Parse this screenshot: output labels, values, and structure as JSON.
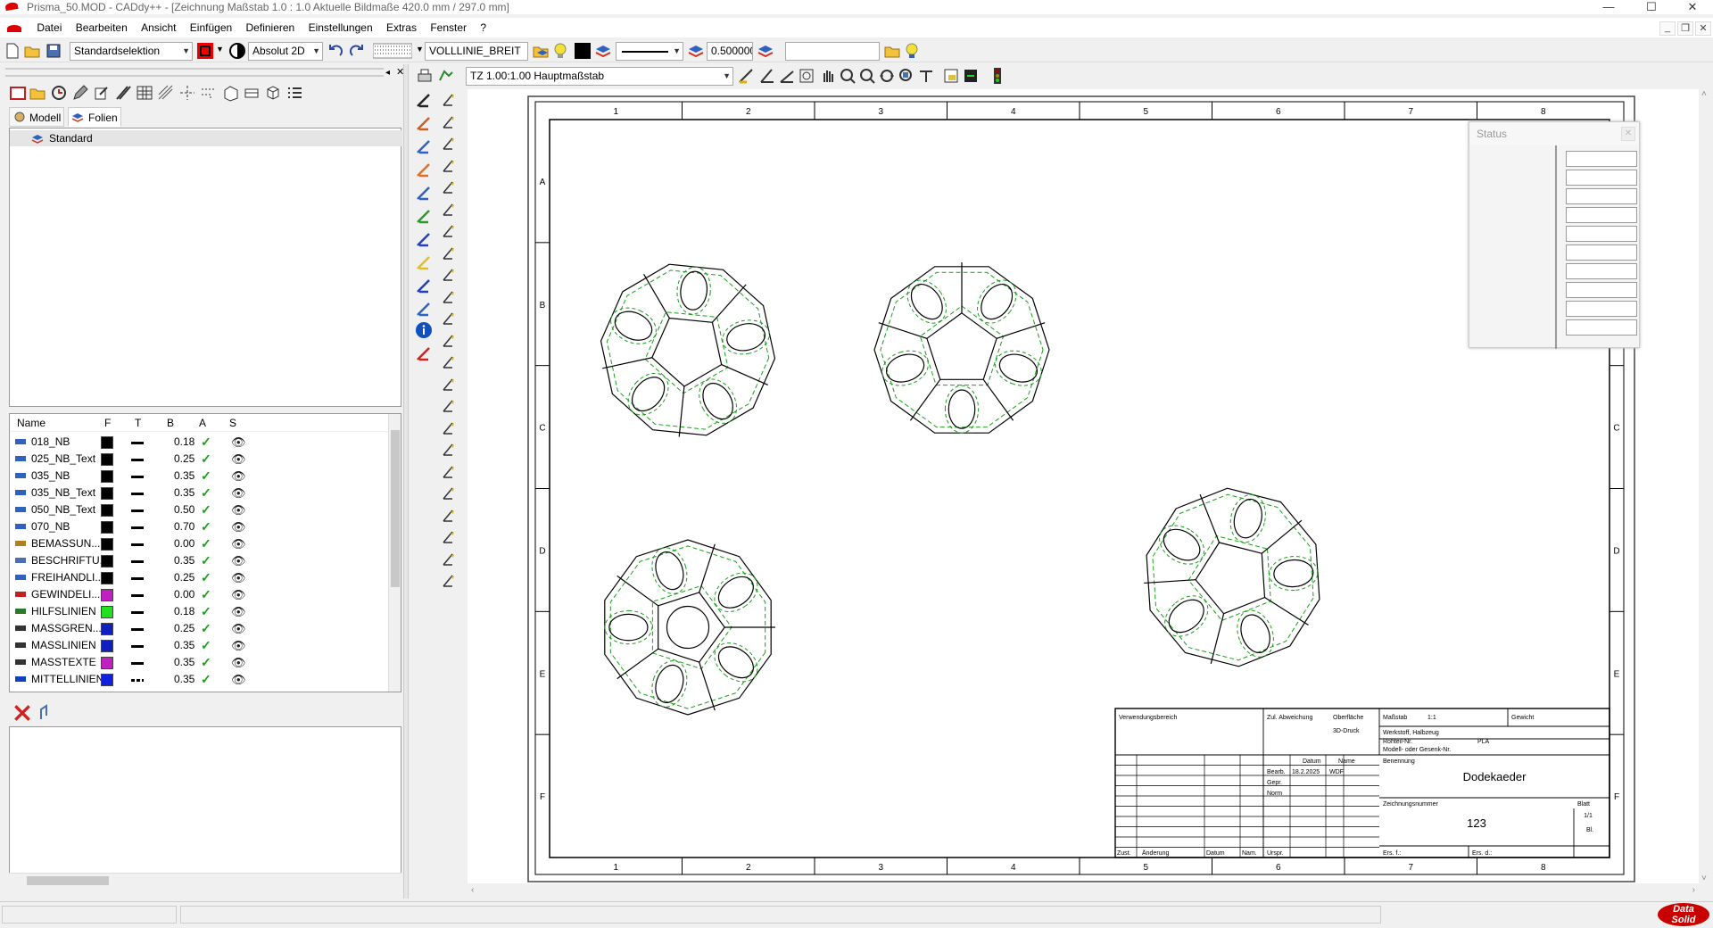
{
  "window": {
    "title": "Prisma_50.MOD  -  CADdy++ - [Zeichnung   Maßstab 1.0 : 1.0   Aktuelle Bildmaße 420.0 mm / 297.0 mm]",
    "min": "—",
    "max": "☐",
    "close": "✕"
  },
  "menu": {
    "items": [
      "Datei",
      "Bearbeiten",
      "Ansicht",
      "Einfügen",
      "Definieren",
      "Einstellungen",
      "Extras",
      "Fenster",
      "?"
    ]
  },
  "toolbar": {
    "selection_mode": "Standardselektion",
    "coord_mode": "Absolut 2D",
    "line_type": "VOLLLINIE_BREIT",
    "line_width": "0.500000",
    "search_value": ""
  },
  "drawing_toolbar": {
    "scale": "TZ 1.00:1.00 Hauptmaßstab"
  },
  "tabs": {
    "modell": "Modell",
    "folien": "Folien"
  },
  "tree": {
    "root": "Standard"
  },
  "layers": {
    "headers": {
      "name": "Name",
      "f": "F",
      "t": "T",
      "b": "B",
      "a": "A",
      "s": "S"
    },
    "rows": [
      {
        "name": "018_NB",
        "color": "#000000",
        "b": "0.18"
      },
      {
        "name": "025_NB_Text",
        "color": "#000000",
        "b": "0.25"
      },
      {
        "name": "035_NB",
        "color": "#000000",
        "b": "0.35"
      },
      {
        "name": "035_NB_Text",
        "color": "#000000",
        "b": "0.35"
      },
      {
        "name": "050_NB_Text",
        "color": "#000000",
        "b": "0.50"
      },
      {
        "name": "070_NB",
        "color": "#000000",
        "b": "0.70"
      },
      {
        "name": "BEMASSUN...",
        "color": "#000000",
        "b": "0.00"
      },
      {
        "name": "BESCHRIFTU...",
        "color": "#000000",
        "b": "0.35"
      },
      {
        "name": "FREIHANDLI...",
        "color": "#000000",
        "b": "0.25"
      },
      {
        "name": "GEWINDELI...",
        "color": "#c020c0",
        "b": "0.00"
      },
      {
        "name": "HILFSLINIEN",
        "color": "#20e020",
        "b": "0.18"
      },
      {
        "name": "MASSGREN...",
        "color": "#1020c0",
        "b": "0.25"
      },
      {
        "name": "MASSLINIEN",
        "color": "#1020c0",
        "b": "0.35"
      },
      {
        "name": "MASSTEXTE",
        "color": "#c020c0",
        "b": "0.35"
      },
      {
        "name": "MITTELLINIEN",
        "color": "#1020e0",
        "b": "0.35"
      }
    ]
  },
  "frame": {
    "cols": [
      "1",
      "2",
      "3",
      "4",
      "5",
      "6",
      "7",
      "8"
    ],
    "rows": [
      "A",
      "B",
      "C",
      "D",
      "E",
      "F"
    ]
  },
  "titleblock": {
    "verwendungsbereich": "Verwendungsbereich",
    "zul_abweichung": "Zul. Abweichung",
    "oberflaeche": "Oberfläche",
    "oberflaeche_val": "3D-Druck",
    "massstab": "Maßstab",
    "massstab_val": "1:1",
    "gewicht": "Gewicht",
    "werkstoff": "Werkstoff, Halbzeug",
    "rohteil": "Rohteil-Nr.",
    "rohteil_val": "PLA",
    "modell": "Modell- oder Gesenk-Nr.",
    "datum": "Datum",
    "name": "Name",
    "benennung": "Benennung",
    "bearb": "Bearb.",
    "bearb_datum": "18.2.2025",
    "bearb_name": "WDF",
    "gepr": "Gepr.",
    "norm": "Norm",
    "title": "Dodekaeder",
    "zeichnungsnummer": "Zeichnungsnummer",
    "number": "123",
    "blatt": "Blatt",
    "blatt_val": "1/1",
    "bl": "Bl.",
    "zust": "Zust.",
    "aenderung": "Änderung",
    "datum2": "Datum",
    "nam": "Nam.",
    "urspr": "Urspr.",
    "ers": "Ers. f.:",
    "ers2": "Ers. d.:"
  },
  "status_window": {
    "title": "Status",
    "close": "✕"
  },
  "brand": {
    "line1": "Data",
    "line2": "Solid"
  }
}
